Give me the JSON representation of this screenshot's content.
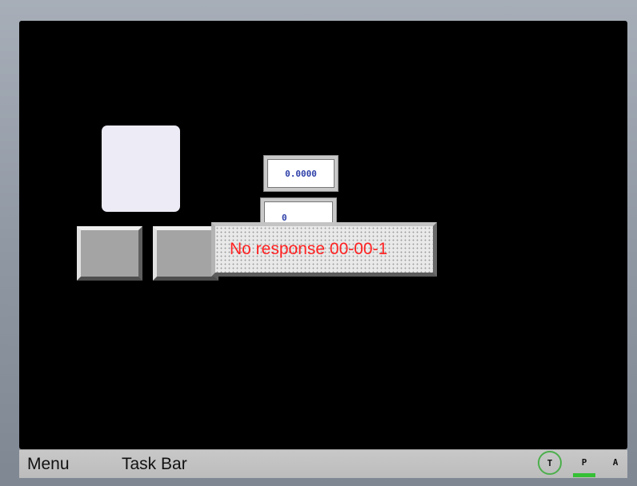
{
  "screen": {
    "numeric_display_1": "0.0000",
    "numeric_display_2": "0",
    "alert_message": "No response 00-00-1"
  },
  "taskbar": {
    "menu_label": "Menu",
    "taskbar_label": "Task Bar",
    "indicators": [
      {
        "label": "T",
        "style": "circled",
        "color": "#4caf4c"
      },
      {
        "label": "P",
        "style": "underlined",
        "color": "#35c035"
      },
      {
        "label": "A",
        "style": "plain"
      }
    ]
  },
  "colors": {
    "screen_background": "#000000",
    "alert_text": "#ff2222",
    "numeric_text": "#2d3fa8",
    "bezel": "#8f97a3"
  }
}
